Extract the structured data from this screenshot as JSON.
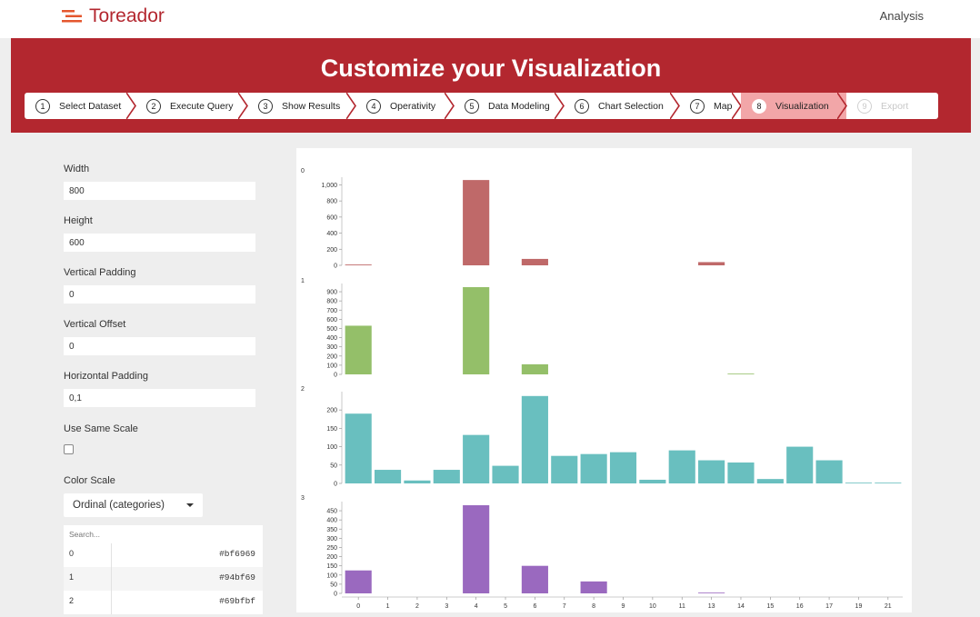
{
  "app": {
    "brand": "Toreador",
    "nav_analysis": "Analysis"
  },
  "header": {
    "title": "Customize your Visualization"
  },
  "steps": [
    {
      "num": "1",
      "label": "Select Dataset",
      "state": "done"
    },
    {
      "num": "2",
      "label": "Execute Query",
      "state": "done"
    },
    {
      "num": "3",
      "label": "Show Results",
      "state": "done"
    },
    {
      "num": "4",
      "label": "Operativity",
      "state": "done"
    },
    {
      "num": "5",
      "label": "Data Modeling",
      "state": "done"
    },
    {
      "num": "6",
      "label": "Chart Selection",
      "state": "done"
    },
    {
      "num": "7",
      "label": "Map",
      "state": "done"
    },
    {
      "num": "8",
      "label": "Visualization",
      "state": "active"
    },
    {
      "num": "9",
      "label": "Export",
      "state": "disabled"
    }
  ],
  "controls": {
    "width": {
      "label": "Width",
      "value": "800"
    },
    "height": {
      "label": "Height",
      "value": "600"
    },
    "vpadding": {
      "label": "Vertical Padding",
      "value": "0"
    },
    "voffset": {
      "label": "Vertical Offset",
      "value": "0"
    },
    "hpadding": {
      "label": "Horizontal Padding",
      "value": "0,1"
    },
    "samescale": {
      "label": "Use Same Scale",
      "checked": false
    },
    "colorscale": {
      "label": "Color Scale",
      "value": "Ordinal (categories)"
    },
    "search_placeholder": "Search...",
    "colors": [
      {
        "key": "0",
        "value": "#bf6969"
      },
      {
        "key": "1",
        "value": "#94bf69"
      },
      {
        "key": "2",
        "value": "#69bfbf"
      }
    ]
  },
  "chart_data": {
    "type": "bar",
    "layout": "small-multiples",
    "categories": [
      "0",
      "1",
      "2",
      "3",
      "4",
      "5",
      "6",
      "7",
      "8",
      "9",
      "10",
      "11",
      "13",
      "14",
      "15",
      "16",
      "17",
      "19",
      "21"
    ],
    "series": [
      {
        "name": "0",
        "color": "#bf6969",
        "ticks": [
          0,
          200,
          400,
          600,
          800,
          "1,000"
        ],
        "ymax": 1050,
        "values": [
          10,
          0,
          0,
          0,
          1060,
          0,
          80,
          0,
          0,
          0,
          0,
          0,
          40,
          0,
          0,
          0,
          0,
          0,
          0
        ]
      },
      {
        "name": "1",
        "color": "#94bf69",
        "ticks": [
          0,
          100,
          200,
          300,
          400,
          500,
          600,
          700,
          800,
          900
        ],
        "ymax": 950,
        "values": [
          530,
          0,
          0,
          0,
          950,
          0,
          110,
          0,
          0,
          0,
          0,
          0,
          0,
          2,
          0,
          0,
          0,
          0,
          0
        ]
      },
      {
        "name": "2",
        "color": "#69bfbf",
        "ticks": [
          0,
          50,
          100,
          150,
          200
        ],
        "ymax": 240,
        "values": [
          190,
          37,
          8,
          37,
          132,
          48,
          238,
          75,
          80,
          85,
          10,
          90,
          63,
          57,
          12,
          100,
          63,
          2,
          2
        ]
      },
      {
        "name": "3",
        "color": "#9a69bf",
        "ticks": [
          0,
          50,
          100,
          150,
          200,
          250,
          300,
          350,
          400,
          450
        ],
        "ymax": 480,
        "values": [
          125,
          0,
          0,
          0,
          480,
          0,
          150,
          0,
          65,
          0,
          0,
          0,
          3,
          0,
          0,
          0,
          0,
          0,
          0
        ]
      }
    ]
  }
}
